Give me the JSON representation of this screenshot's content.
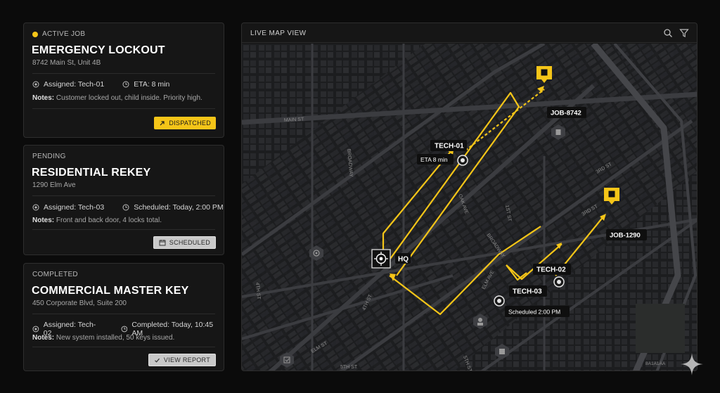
{
  "jobs": [
    {
      "status": "ACTIVE JOB",
      "title": "EMERGENCY LOCKOUT",
      "address": "8742 Main St, Unit 4B",
      "assigned": "Assigned: Tech-01",
      "time": "ETA: 8 min",
      "notes_label": "Notes:",
      "notes": "Customer locked out, child inside. Priority high.",
      "badge": "DISPATCHED"
    },
    {
      "status": "PENDING",
      "title": "RESIDENTIAL REKEY",
      "address": "1290 Elm Ave",
      "assigned": "Assigned: Tech-03",
      "time": "Scheduled: Today, 2:00 PM",
      "notes_label": "Notes:",
      "notes": "Front and back door, 4 locks total.",
      "badge": "SCHEDULED"
    },
    {
      "status": "COMPLETED",
      "title": "COMMERCIAL MASTER KEY",
      "address": "450 Corporate Blvd, Suite 200",
      "assigned": "Assigned: Tech-02",
      "time": "Completed: Today, 10:45 AM",
      "notes_label": "Notes:",
      "notes": "New system installed, 50 keys issued.",
      "badge": "VIEW REPORT"
    }
  ],
  "map": {
    "title": "LIVE MAP VIEW",
    "tools": [
      "search-icon",
      "filter-icon"
    ],
    "markers": {
      "hq": "HQ",
      "job1": "JOB-8742",
      "job2": "JOB-1290",
      "tech1": "TECH-01",
      "tech1_eta": "ETA 8 min",
      "tech2": "TECH-02",
      "tech3": "TECH-03",
      "tech3_sched": "Scheduled 2:00 PM"
    },
    "streets": [
      "MAIN ST",
      "BROADWAY",
      "4TH ST",
      "4TH ST",
      "ELM AVE",
      "BROADWAY",
      "1ST ST",
      "3RD ST",
      "5TH ST",
      "3RD ST",
      "ELM ST",
      "OAK AVE",
      "5TH ST"
    ],
    "code": "8A1A1AA"
  },
  "colors": {
    "accent": "#f5c518",
    "background": "#0b0b0b",
    "panel": "#161616",
    "map_base": "#1e1f21",
    "route": "#f5c518"
  }
}
